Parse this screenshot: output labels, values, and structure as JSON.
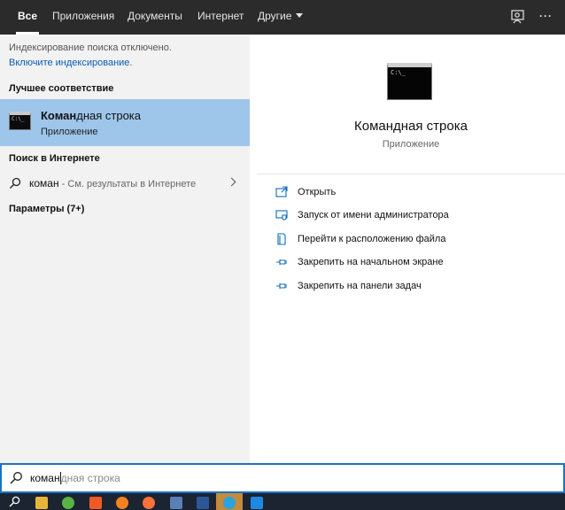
{
  "tabs": [
    {
      "label": "Все",
      "active": true
    },
    {
      "label": "Приложения",
      "active": false
    },
    {
      "label": "Документы",
      "active": false
    },
    {
      "label": "Интернет",
      "active": false
    },
    {
      "label": "Другие",
      "active": false
    }
  ],
  "top_icons": [
    "feedback-icon",
    "more-options-icon"
  ],
  "more_label": "···",
  "left": {
    "indexing_off": "Индексирование поиска отключено.",
    "indexing_link": "Включите индексирование.",
    "best_match_header": "Лучшее соответствие",
    "best_match": {
      "title_bold": "Коман",
      "title_rest": "дная строка",
      "subtitle": "Приложение",
      "icon": "command-prompt-icon",
      "icon_text": "C:\\_"
    },
    "web_header": "Поиск в Интернете",
    "web_query": "коман",
    "web_hint": " - См. результаты в Интернете",
    "settings_header": "Параметры (7+)"
  },
  "right": {
    "app_title": "Командная строка",
    "app_subtitle": "Приложение",
    "icon_text": "C:\\_",
    "actions": [
      {
        "label": "Открыть",
        "icon": "open-icon"
      },
      {
        "label": "Запуск от имени администратора",
        "icon": "run-as-admin-icon"
      },
      {
        "label": "Перейти к расположению файла",
        "icon": "file-location-icon"
      },
      {
        "label": "Закрепить на начальном экране",
        "icon": "pin-start-icon"
      },
      {
        "label": "Закрепить на панели задач",
        "icon": "pin-taskbar-icon"
      }
    ]
  },
  "search": {
    "typed": "коман",
    "suggestion": "дная строка"
  },
  "taskbar_icons": [
    "search-icon",
    "file-explorer-icon",
    "utorrent-icon",
    "brave-icon",
    "avast-icon",
    "firefox-icon",
    "app-icon",
    "word-icon",
    "telegram-icon",
    "store-icon"
  ],
  "colors": {
    "topbar": "#2b2b2b",
    "best_match_highlight": "#9ec6eb",
    "link": "#0a5bb5",
    "search_border": "#1a73c6",
    "action_icon": "#0f6cbd"
  }
}
